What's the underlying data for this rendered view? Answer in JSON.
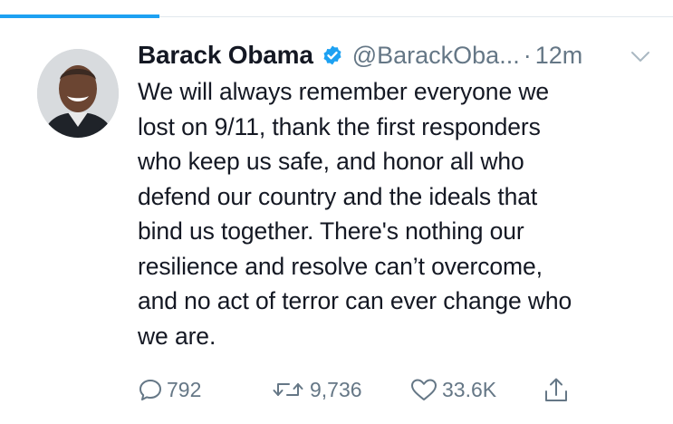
{
  "tweet": {
    "author": {
      "display_name": "Barack Obama",
      "handle": "@BarackOba...",
      "verified": true,
      "avatar_icon": "profile-photo"
    },
    "separator": "·",
    "time": "12m",
    "text": "We will always remember everyone we\nlost on 9/11, thank the first responders\nwho keep us safe, and honor all who\ndefend our country and the ideals that\nbind us together. There's nothing our\nresilience and resolve can’t overcome,\nand no act of terror can ever change who\nwe are.",
    "actions": {
      "replies": "792",
      "retweets": "9,736",
      "likes": "33.6K"
    }
  },
  "colors": {
    "accent": "#1da1f2",
    "text": "#141823",
    "secondary": "#657786",
    "verified": "#1da1f2"
  },
  "icons": {
    "verified": "verified-badge-icon",
    "menu": "chevron-down-icon",
    "reply": "reply-icon",
    "retweet": "retweet-icon",
    "like": "heart-icon",
    "share": "share-icon"
  }
}
